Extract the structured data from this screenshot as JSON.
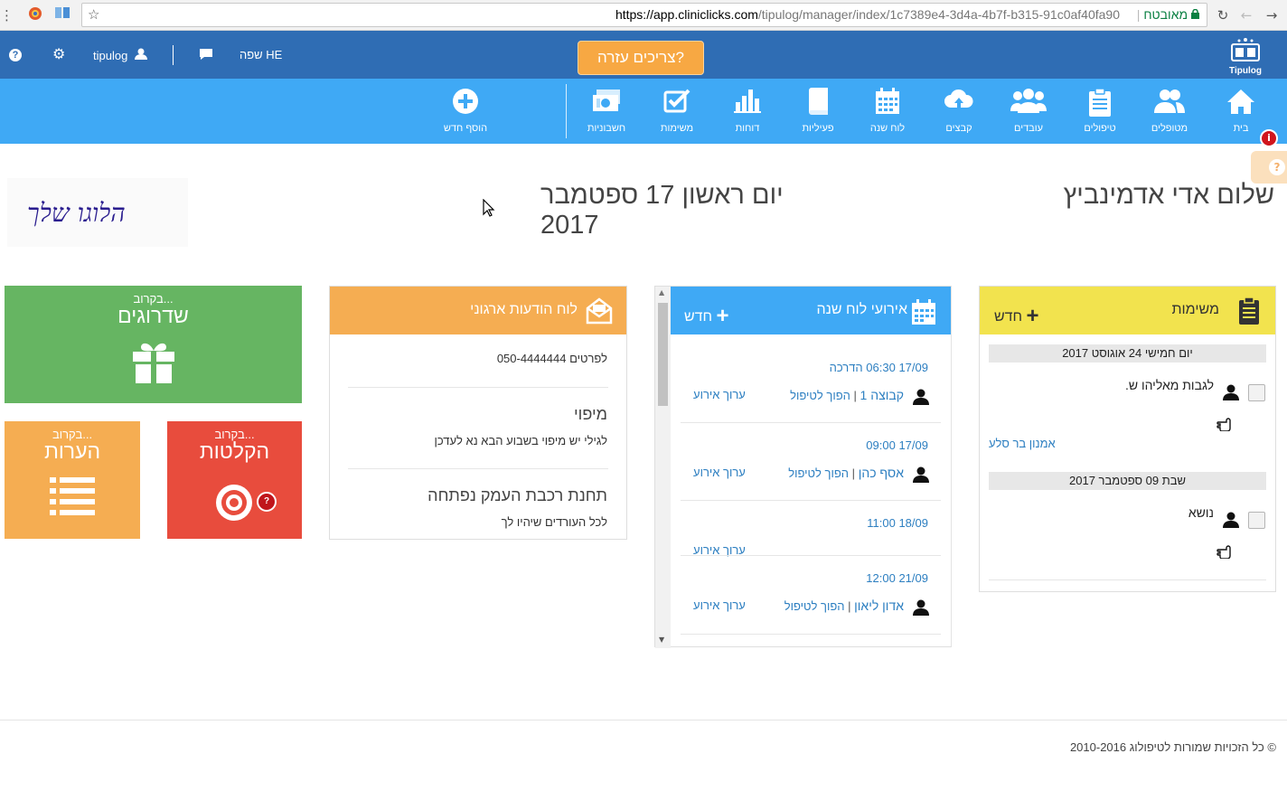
{
  "browser": {
    "url_host": "https://app.cliniclicks.com",
    "url_path": "/tipulog/manager/index/1c7389e4-3d4a-4b7f-b315-91c0af40fa90",
    "secure_label": "מאובטח"
  },
  "topbar": {
    "username": "tipulog",
    "language": "שפה HE",
    "help_button": "צריכים עזרה?",
    "brand": "Tipulog"
  },
  "nav": {
    "items": [
      {
        "label": "בית",
        "icon": "home-icon"
      },
      {
        "label": "מטופלים",
        "icon": "patients-icon"
      },
      {
        "label": "טיפולים",
        "icon": "clipboard-icon"
      },
      {
        "label": "עובדים",
        "icon": "workers-icon"
      },
      {
        "label": "קבצים",
        "icon": "cloud-upload-icon"
      },
      {
        "label": "לוח שנה",
        "icon": "calendar-icon"
      },
      {
        "label": "פעיליות",
        "icon": "book-icon"
      },
      {
        "label": "דוחות",
        "icon": "bar-chart-icon"
      },
      {
        "label": "משימות",
        "icon": "checkbox-icon"
      },
      {
        "label": "חשבוניות",
        "icon": "money-icon"
      },
      {
        "label": "הוסף חדש",
        "icon": "plus-circle-icon"
      }
    ],
    "notification_badge": "i",
    "side_help": "?"
  },
  "header": {
    "greeting": "שלום אדי אדמינביץ",
    "date": "יום ראשון 17 ספטמבר 2017",
    "logo_text": "הלוגו שלך"
  },
  "tasks_panel": {
    "title": "משימות",
    "add_label": "חדש",
    "days": [
      {
        "date": "יום חמישי 24 אוגוסט 2017",
        "task": "לגבות מאליהו ש.",
        "link": "אמנון בר סלע"
      },
      {
        "date": "שבת 09 ספטמבר 2017",
        "task": "נושא",
        "link": ""
      }
    ]
  },
  "events_panel": {
    "title": "אירועי לוח שנה",
    "add_label": "חדש",
    "edit_label": "ערוך אירוע",
    "events": [
      {
        "time": "17/09 06:30",
        "desc": "הדרכה",
        "person": "קבוצה 1",
        "convert": "הפוך לטיפול"
      },
      {
        "time": "17/09 09:00",
        "desc": "",
        "person": "אסף כהן",
        "convert": "הפוך לטיפול"
      },
      {
        "time": "18/09 11:00",
        "desc": "",
        "person": "",
        "convert": ""
      },
      {
        "time": "21/09 12:00",
        "desc": "",
        "person": "אדון ליאון",
        "convert": "הפוך לטיפול"
      }
    ]
  },
  "board_panel": {
    "title": "לוח הודעות ארגוני",
    "messages": [
      {
        "title": "",
        "body": "לפרטים 050-4444444"
      },
      {
        "title": "מיפוי",
        "body": "לגילי יש מיפוי בשבוע הבא נא לעדכן"
      },
      {
        "title": "תחנת רכבת העמק נפתחה",
        "body": "לכל העורדים שיהיו לך"
      }
    ]
  },
  "tiles": {
    "upgrades": {
      "soon": "בקרוב...",
      "title": "שדרוגים"
    },
    "recordings": {
      "soon": "בקרוב...",
      "title": "הקלטות"
    },
    "notes": {
      "soon": "בקרוב...",
      "title": "הערות"
    }
  },
  "footer": {
    "copyright": "© כל הזכויות שמורות לטיפולוג 2010-2016"
  },
  "colors": {
    "topbar": "#2f6db4",
    "navbar": "#3fa9f5",
    "help_button": "#f7a843",
    "tasks_header": "#f2e34e",
    "events_header": "#3fa9f5",
    "board_header": "#f5ad52",
    "tile_green": "#66b562",
    "tile_red": "#e84c3d",
    "tile_orange": "#f5ad52"
  }
}
